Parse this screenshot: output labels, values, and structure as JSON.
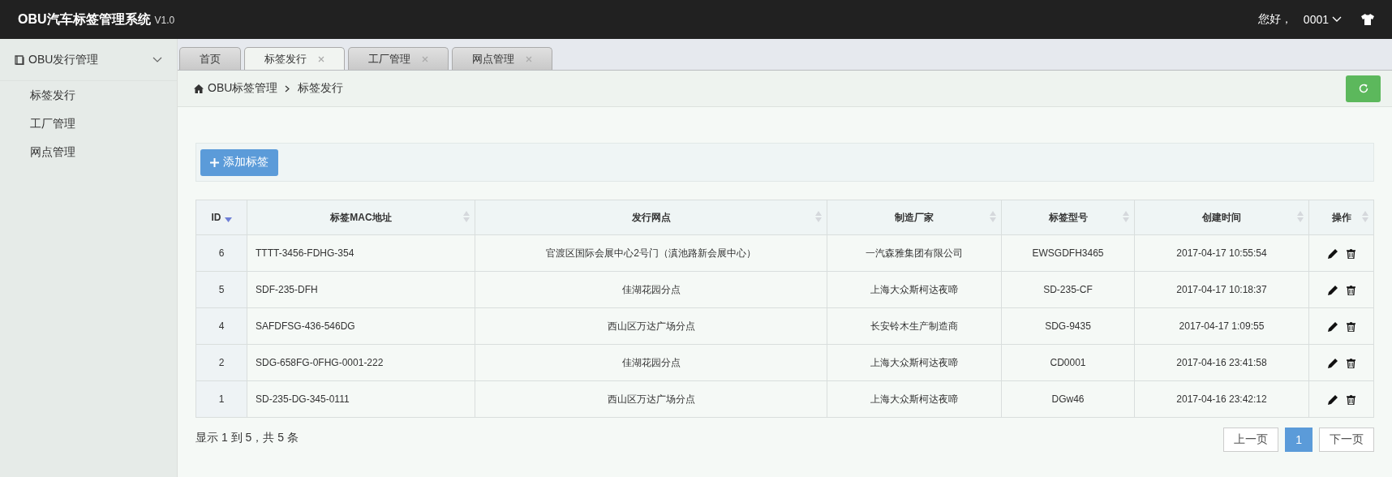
{
  "header": {
    "title": "OBU汽车标签管理系统",
    "version": "V1.0",
    "greeting": "您好，",
    "user": "0001"
  },
  "sidebar": {
    "group": {
      "label": "OBU发行管理",
      "expanded": true,
      "items": [
        {
          "label": "标签发行"
        },
        {
          "label": "工厂管理"
        },
        {
          "label": "网点管理"
        }
      ]
    }
  },
  "tabs": [
    {
      "label": "首页",
      "selected": false,
      "closable": false
    },
    {
      "label": "标签发行",
      "selected": true,
      "closable": true
    },
    {
      "label": "工厂管理",
      "selected": false,
      "closable": true
    },
    {
      "label": "网点管理",
      "selected": false,
      "closable": true
    }
  ],
  "breadcrumb": [
    "OBU标签管理",
    "标签发行"
  ],
  "toolbar": {
    "add_button": "添加标签"
  },
  "table": {
    "columns": [
      {
        "label": "ID",
        "sorted": true
      },
      {
        "label": "标签MAC地址",
        "sorted": false
      },
      {
        "label": "发行网点",
        "sorted": false
      },
      {
        "label": "制造厂家",
        "sorted": false
      },
      {
        "label": "标签型号",
        "sorted": false
      },
      {
        "label": "创建时间",
        "sorted": false
      },
      {
        "label": "操作",
        "sorted": false
      }
    ],
    "rows": [
      [
        "6",
        "TTTT-3456-FDHG-354",
        "官渡区国际会展中心2号门（滇池路新会展中心）",
        "一汽森雅集团有限公司",
        "EWSGDFH3465",
        "2017-04-17 10:55:54"
      ],
      [
        "5",
        "SDF-235-DFH",
        "佳湖花园分点",
        "上海大众斯柯达夜啼",
        "SD-235-CF",
        "2017-04-17 10:18:37"
      ],
      [
        "4",
        "SAFDFSG-436-546DG",
        "西山区万达广场分点",
        "长安铃木生产制造商",
        "SDG-9435",
        "2017-04-17 1:09:55"
      ],
      [
        "2",
        "SDG-658FG-0FHG-0001-222",
        "佳湖花园分点",
        "上海大众斯柯达夜啼",
        "CD0001",
        "2017-04-16 23:41:58"
      ],
      [
        "1",
        "SD-235-DG-345-0111",
        "西山区万达广场分点",
        "上海大众斯柯达夜啼",
        "DGw46",
        "2017-04-16 23:42:12"
      ]
    ]
  },
  "footer": {
    "summary": "显示 1 到 5，共 5 条",
    "pagination": [
      {
        "label": "上一页",
        "selected": false
      },
      {
        "label": "1",
        "selected": true
      },
      {
        "label": "下一页",
        "selected": false
      }
    ]
  }
}
